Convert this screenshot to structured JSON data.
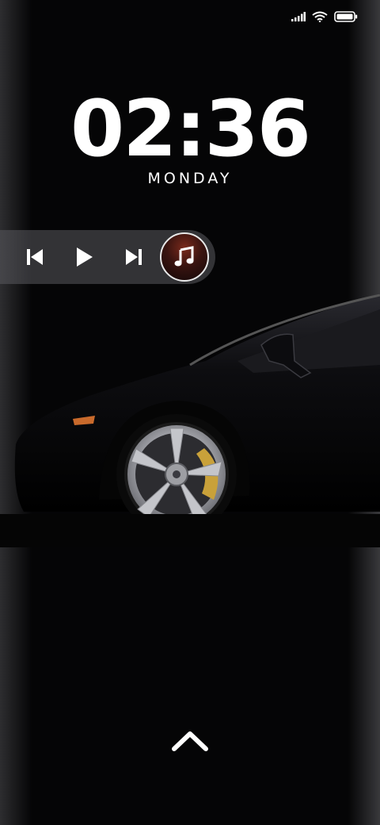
{
  "status_bar": {
    "icons": [
      "signal-icon",
      "wifi-icon",
      "battery-icon"
    ]
  },
  "lockscreen": {
    "time": "02:36",
    "day": "MONDAY"
  },
  "media_controls": {
    "buttons": [
      "previous-track",
      "play",
      "next-track"
    ],
    "album_art_icon": "music-note-icon"
  },
  "unlock": {
    "icon": "chevron-up-icon"
  },
  "colors": {
    "background": "#050506",
    "text": "#ffffff",
    "media_bar": "#5a5a5f"
  }
}
